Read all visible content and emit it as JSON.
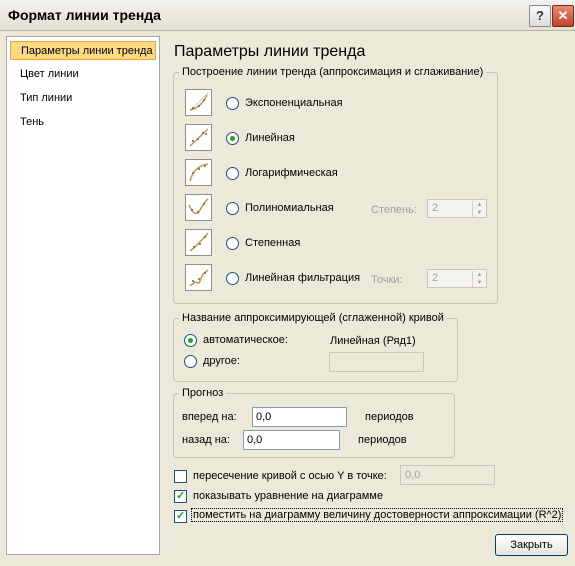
{
  "window": {
    "title": "Формат линии тренда",
    "help_label": "?",
    "close_label": "✕"
  },
  "nav": {
    "items": [
      {
        "label": "Параметры линии тренда",
        "selected": true
      },
      {
        "label": "Цвет линии",
        "selected": false
      },
      {
        "label": "Тип линии",
        "selected": false
      },
      {
        "label": "Тень",
        "selected": false
      }
    ]
  },
  "panel": {
    "title": "Параметры линии тренда",
    "trend_group": {
      "legend": "Построение линии тренда (аппроксимация и сглаживание)",
      "options": [
        {
          "label": "Экспоненциальная",
          "selected": false,
          "icon": "exponential-trend-icon"
        },
        {
          "label": "Линейная",
          "selected": true,
          "icon": "linear-trend-icon"
        },
        {
          "label": "Логарифмическая",
          "selected": false,
          "icon": "logarithmic-trend-icon"
        },
        {
          "label": "Полиномиальная",
          "selected": false,
          "icon": "polynomial-trend-icon"
        },
        {
          "label": "Степенная",
          "selected": false,
          "icon": "power-trend-icon"
        },
        {
          "label": "Линейная фильтрация",
          "selected": false,
          "icon": "moving-average-trend-icon"
        }
      ],
      "degree_label": "Степень:",
      "degree_value": "2",
      "points_label": "Точки:",
      "points_value": "2"
    },
    "name_group": {
      "legend": "Название аппроксимирующей (сглаженной) кривой",
      "auto_label": "автоматическое:",
      "auto_value": "Линейная (Ряд1)",
      "custom_label": "другое:",
      "custom_value": ""
    },
    "forecast_group": {
      "legend": "Прогноз",
      "forward_label": "вперед на:",
      "forward_value": "0,0",
      "backward_label": "назад на:",
      "backward_value": "0,0",
      "periods_label": "периодов"
    },
    "intercept": {
      "label": "пересечение кривой с осью Y в точке:",
      "value": "0,0",
      "checked": false
    },
    "show_equation": {
      "label": "показывать уравнение на диаграмме",
      "checked": true
    },
    "show_r2": {
      "label": "поместить на диаграмму величину достоверности аппроксимации (R^2)",
      "checked": true
    }
  },
  "buttons": {
    "close_label": "Закрыть"
  },
  "colors": {
    "selection": "#ffd884",
    "dialog_bg": "#ece9d8",
    "check": "#21a121"
  }
}
